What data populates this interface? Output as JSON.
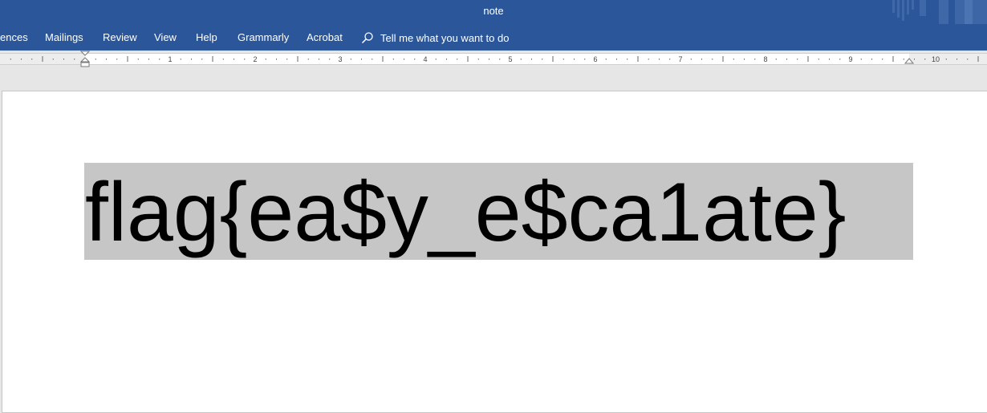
{
  "window": {
    "title": "note"
  },
  "ribbon": {
    "tabs": [
      {
        "label": "ences"
      },
      {
        "label": "Mailings"
      },
      {
        "label": "Review"
      },
      {
        "label": "View"
      },
      {
        "label": "Help"
      },
      {
        "label": "Grammarly"
      },
      {
        "label": "Acrobat"
      }
    ],
    "tell_me": {
      "icon": "search-icon",
      "label": "Tell me what you want to do"
    }
  },
  "ruler": {
    "numbers": [
      "1",
      "2",
      "3",
      "4",
      "5",
      "6",
      "7",
      "8",
      "9",
      "10"
    ]
  },
  "document": {
    "text": "flag{ea$y_e$ca1ate}",
    "selected": true
  },
  "colors": {
    "ribbon": "#2b579a",
    "workspace": "#e6e6e6",
    "selection": "#c6c6c6",
    "text": "#000000"
  }
}
